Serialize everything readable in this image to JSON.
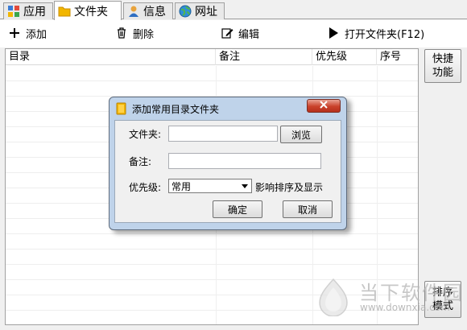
{
  "tabs": [
    {
      "label": "应用",
      "icon": "app-grid-icon",
      "active": false
    },
    {
      "label": "文件夹",
      "icon": "folder-icon",
      "active": true
    },
    {
      "label": "信息",
      "icon": "person-icon",
      "active": false
    },
    {
      "label": "网址",
      "icon": "globe-icon",
      "active": false
    }
  ],
  "toolbar": {
    "add_label": "添加",
    "delete_label": "删除",
    "edit_label": "编辑",
    "open_label": "打开文件夹(F12)"
  },
  "list": {
    "columns": [
      "目录",
      "备注",
      "优先级",
      "序号"
    ]
  },
  "side": {
    "quick_label": "快捷\n功能",
    "sort_label": "排序\n模式"
  },
  "dialog": {
    "title": "添加常用目录文件夹",
    "folder_label": "文件夹:",
    "folder_value": "",
    "browse_label": "浏览",
    "note_label": "备注:",
    "note_value": "",
    "priority_label": "优先级:",
    "priority_value": "常用",
    "priority_hint": "影响排序及显示",
    "ok_label": "确定",
    "cancel_label": "取消"
  },
  "watermark": {
    "brand": "当下软件园",
    "url": "www.downxia.com"
  },
  "colors": {
    "dialog_frame": "#bfd3ea",
    "close_red": "#c9412b",
    "accent_folder": "#f2b600"
  }
}
